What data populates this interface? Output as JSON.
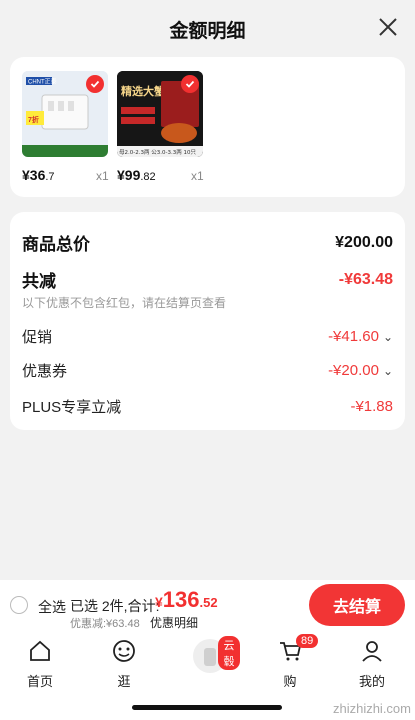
{
  "header": {
    "title": "金额明细"
  },
  "products": [
    {
      "price_int": "¥36",
      "price_dec": ".7",
      "qty": "x1",
      "brand": "CHNT正泰",
      "image_caption": "7折"
    },
    {
      "price_int": "¥99",
      "price_dec": ".82",
      "qty": "x1",
      "brand": "精选大蟹",
      "image_caption": "母2.0-2.3两 公3.0-3.3两 10只"
    }
  ],
  "summary": {
    "total_label": "商品总价",
    "total_value": "¥200.00",
    "reduce_label": "共减",
    "reduce_value": "-¥63.48",
    "note": "以下优惠不包含红包，请在结算页查看",
    "items": [
      {
        "label": "促销",
        "value": "-¥41.60"
      },
      {
        "label": "优惠券",
        "value": "-¥20.00"
      },
      {
        "label": "PLUS专享立减",
        "value": "-¥1.88"
      }
    ]
  },
  "footer": {
    "select_all": "全选",
    "selected_text": "已选 2件,合计:",
    "price_yen": "¥",
    "price_int": "136",
    "price_dec": ".52",
    "discount_text": "优惠减:¥63.48",
    "detail_link": "优惠明细",
    "checkout": "去结算"
  },
  "tabbar": {
    "tabs": [
      {
        "label": "首页",
        "icon": "home-icon"
      },
      {
        "label": "逛",
        "icon": "browse-icon"
      },
      {
        "label": "",
        "icon": "product-thumb",
        "badge": "云毂"
      },
      {
        "label": "购",
        "icon": "cart-icon",
        "badge": "89"
      },
      {
        "label": "我的",
        "icon": "profile-icon"
      }
    ]
  },
  "watermark": "zhizhizhi.com",
  "colors": {
    "accent": "#f23030",
    "background": "#f2f2f2"
  }
}
